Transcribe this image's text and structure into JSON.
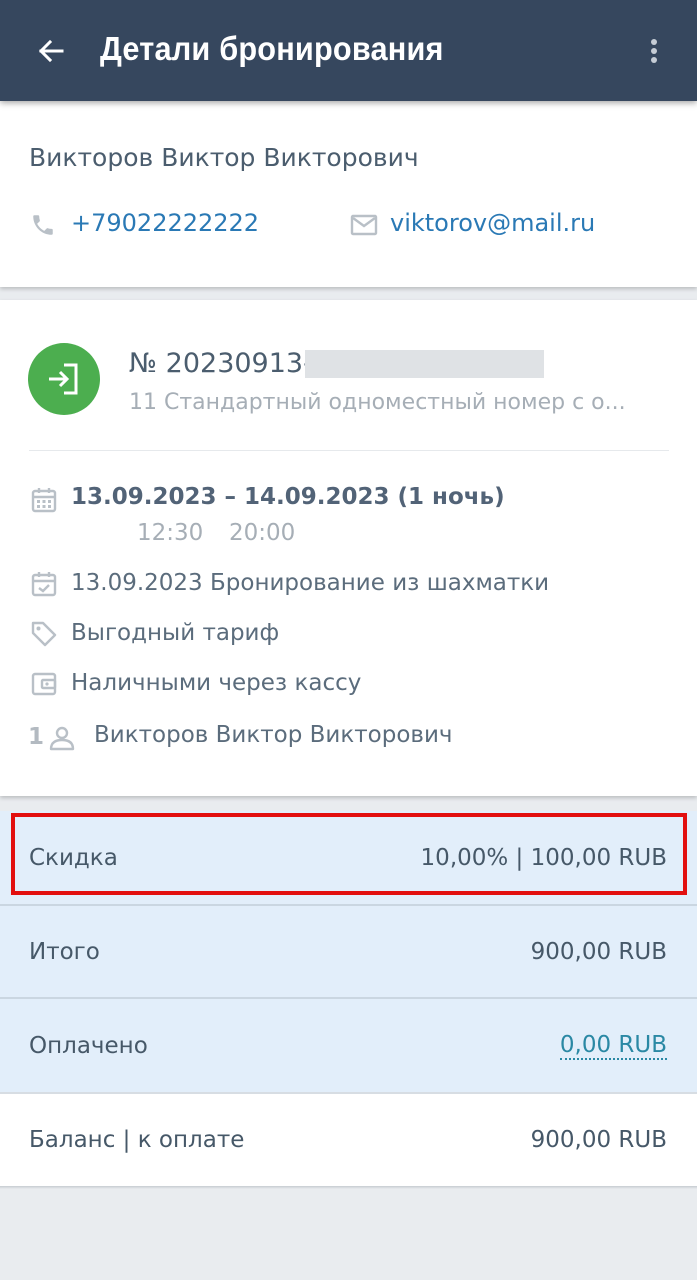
{
  "appbar": {
    "title": "Детали бронирования",
    "back_icon": "arrow-left-icon",
    "menu_icon": "more-vertical-icon"
  },
  "contact": {
    "name": "Викторов Виктор Викторович",
    "phone": "+79022222222",
    "email": "viktorov@mail.ru"
  },
  "booking": {
    "number": "№ 20230913-",
    "room": "11 Стандартный одноместный номер с о...",
    "dates": "13.09.2023 – 14.09.2023 (1 ночь)",
    "checkin_time": "12:30",
    "checkout_time": "20:00",
    "created": "13.09.2023 Бронирование из шахматки",
    "tariff": "Выгодный тариф",
    "payment_method": "Наличными через кассу",
    "guest_count": "1",
    "guest_name": "Викторов Виктор Викторович"
  },
  "summary": {
    "discount_label": "Скидка",
    "discount_value": "10,00% | 100,00 RUB",
    "total_label": "Итого",
    "total_value": "900,00 RUB",
    "paid_label": "Оплачено",
    "paid_value": "0,00 RUB",
    "balance_label": "Баланс | к оплате",
    "balance_value": "900,00 RUB"
  },
  "colors": {
    "appbar": "#36475e",
    "accent_link": "#2a79b5",
    "status_green": "#4cae4f",
    "highlight_red": "#e20f0f"
  }
}
